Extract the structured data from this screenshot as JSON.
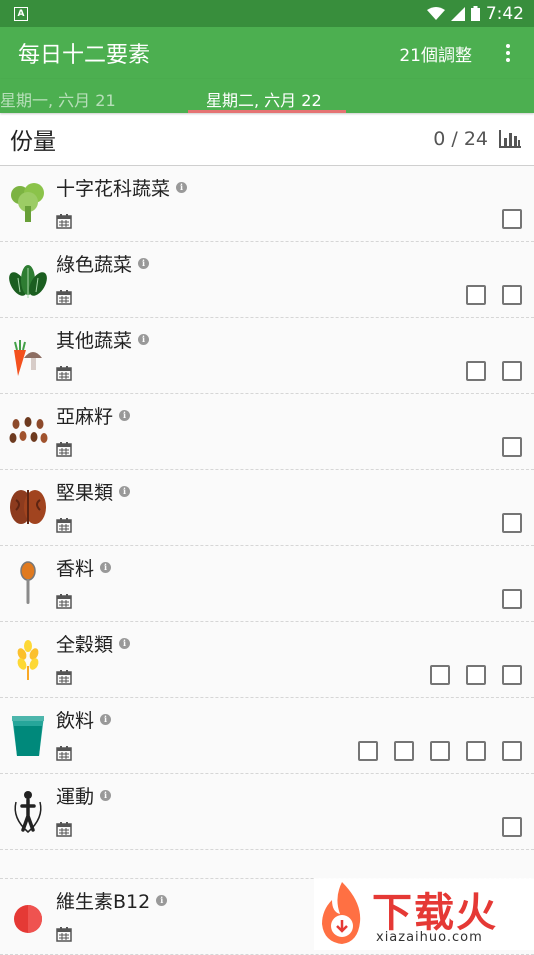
{
  "status_bar": {
    "time": "7:42",
    "left_icon": "A"
  },
  "app_bar": {
    "title": "每日十二要素",
    "action": "21個調整",
    "menu_icon": "more-vert-icon"
  },
  "tabs": {
    "previous": "星期一, 六月 21",
    "current": "星期二, 六月 22",
    "indicator_color": "#e57373"
  },
  "section": {
    "title": "份量",
    "count": "0 / 24",
    "chart_icon": "bar-chart-icon"
  },
  "items": [
    {
      "name": "十字花科蔬菜",
      "icon": "broccoli-icon",
      "checkboxes": 1
    },
    {
      "name": "綠色蔬菜",
      "icon": "leafy-greens-icon",
      "checkboxes": 2
    },
    {
      "name": "其他蔬菜",
      "icon": "carrot-mushroom-icon",
      "checkboxes": 2
    },
    {
      "name": "亞麻籽",
      "icon": "flaxseed-icon",
      "checkboxes": 1
    },
    {
      "name": "堅果類",
      "icon": "walnut-icon",
      "checkboxes": 1
    },
    {
      "name": "香料",
      "icon": "spice-spoon-icon",
      "checkboxes": 1
    },
    {
      "name": "全穀類",
      "icon": "wheat-icon",
      "checkboxes": 3
    },
    {
      "name": "飲料",
      "icon": "cup-icon",
      "checkboxes": 5
    },
    {
      "name": "運動",
      "icon": "jump-rope-icon",
      "checkboxes": 1
    },
    {
      "name": "維生素B12",
      "icon": "vitamin-pill-icon",
      "checkboxes": 0
    }
  ],
  "watermark": {
    "text": "下载火",
    "url": "xiazaihuo.com"
  },
  "colors": {
    "status_bar": "#388e3c",
    "app_bar": "#4caf50",
    "accent": "#e57373"
  }
}
